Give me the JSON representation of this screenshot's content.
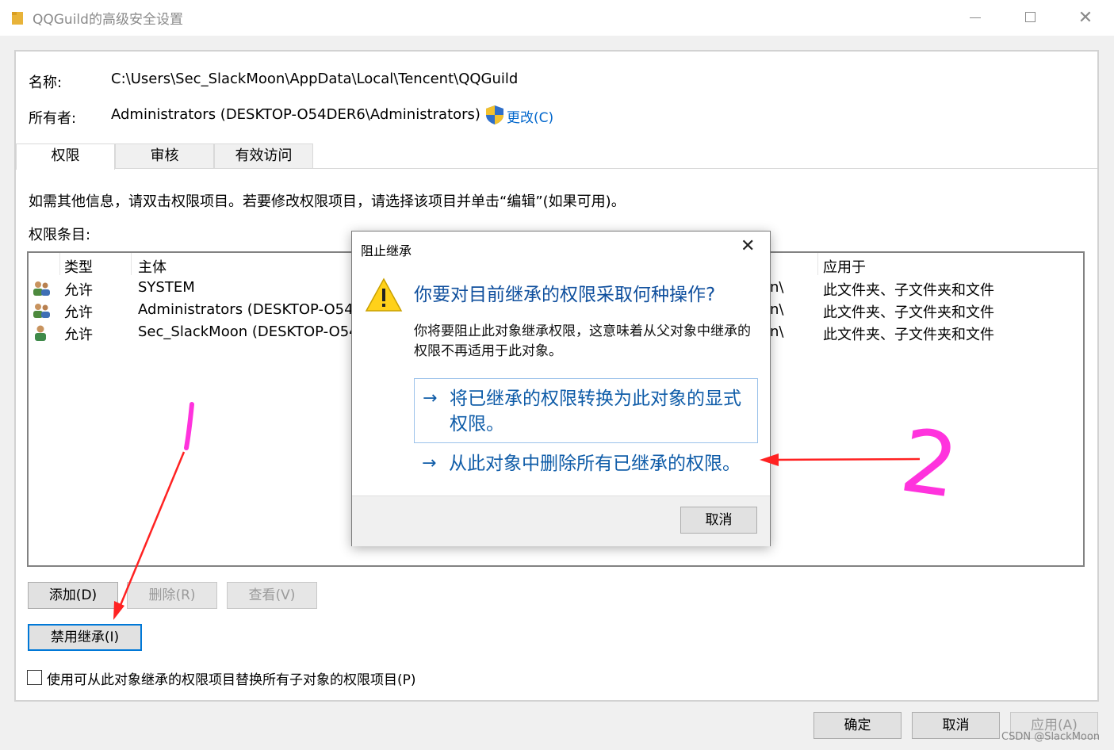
{
  "window": {
    "title": "QQGuild的高级安全设置"
  },
  "info": {
    "name_label": "名称:",
    "name_value": "C:\\Users\\Sec_SlackMoon\\AppData\\Local\\Tencent\\QQGuild",
    "owner_label": "所有者:",
    "owner_value": "Administrators (DESKTOP-O54DER6\\Administrators)",
    "change_link": "更改(C)"
  },
  "tabs": [
    {
      "label": "权限",
      "active": true
    },
    {
      "label": "审核",
      "active": false
    },
    {
      "label": "有效访问",
      "active": false
    }
  ],
  "instructions": "如需其他信息，请双击权限项目。若要修改权限项目，请选择该项目并单击“编辑”(如果可用)。",
  "entries_label": "权限条目:",
  "table": {
    "headers": {
      "type": "类型",
      "principal": "主体",
      "applies": "应用于"
    },
    "rows": [
      {
        "icon": "group-users-icon",
        "type": "允许",
        "principal": "SYSTEM",
        "access_tail": "n\\",
        "applies": "此文件夹、子文件夹和文件"
      },
      {
        "icon": "group-users-icon",
        "type": "允许",
        "principal": "Administrators (DESKTOP-O54I",
        "access_tail": "n\\",
        "applies": "此文件夹、子文件夹和文件"
      },
      {
        "icon": "user-icon",
        "type": "允许",
        "principal": "Sec_SlackMoon (DESKTOP-O54",
        "access_tail": "n\\",
        "applies": "此文件夹、子文件夹和文件"
      }
    ]
  },
  "buttons": {
    "add": "添加(D)",
    "remove": "删除(R)",
    "view": "查看(V)",
    "disable_inheritance": "禁用继承(I)",
    "replace_child_label": "使用可从此对象继承的权限项目替换所有子对象的权限项目(P)",
    "ok": "确定",
    "cancel": "取消",
    "apply": "应用(A)"
  },
  "dialog": {
    "title": "阻止继承",
    "heading": "你要对目前继承的权限采取何种操作?",
    "body": "你将要阻止此对象继承权限，这意味着从父对象中继承的权限不再适用于此对象。",
    "option1": "将已继承的权限转换为此对象的显式权限。",
    "option2": "从此对象中删除所有已继承的权限。",
    "arrow_glyph": "→",
    "cancel": "取消"
  },
  "annotations": {
    "label_2": "2",
    "color_marker": "#ff33dd",
    "color_arrow": "#ff2222"
  },
  "watermark": "CSDN @SlackMoon"
}
